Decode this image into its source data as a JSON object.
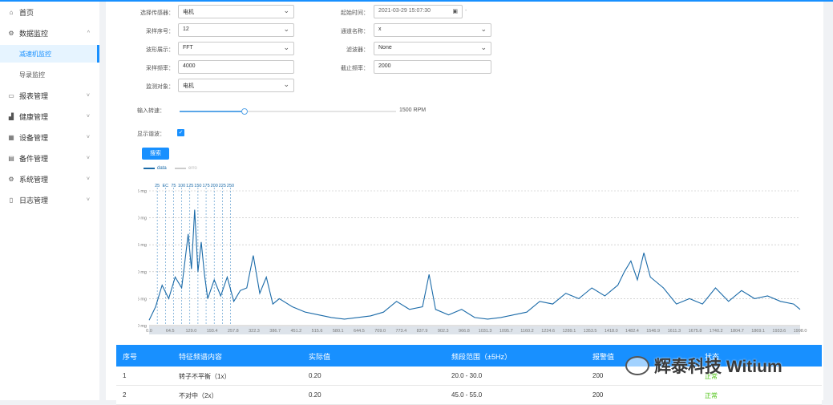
{
  "sidebar": {
    "items": [
      {
        "label": "首页",
        "icon": "home-icon",
        "glyph": "⌂"
      },
      {
        "label": "数据监控",
        "icon": "gear-icon",
        "glyph": "⚙",
        "chevron": "^"
      },
      {
        "label": "减速机监控",
        "sub": true,
        "active": true
      },
      {
        "label": "导录监控",
        "sub": true
      },
      {
        "label": "报表管理",
        "icon": "report-icon",
        "glyph": "▭",
        "chevron": "˅"
      },
      {
        "label": "健康管理",
        "icon": "chart-icon",
        "glyph": "▟",
        "chevron": "˅"
      },
      {
        "label": "设备管理",
        "icon": "device-icon",
        "glyph": "▦",
        "chevron": "˅"
      },
      {
        "label": "备件管理",
        "icon": "parts-icon",
        "glyph": "▤",
        "chevron": "˅"
      },
      {
        "label": "系统管理",
        "icon": "settings-icon",
        "glyph": "⚙",
        "chevron": "˅"
      },
      {
        "label": "日志管理",
        "icon": "log-icon",
        "glyph": "▯",
        "chevron": "˅"
      }
    ]
  },
  "form": {
    "sensor_label": "选择传感器：",
    "sensor_value": "电机",
    "start_time_label": "起始时间：",
    "start_time_value": "2021-03-29 15:07:30",
    "start_time_dash": "-",
    "sample_no_label": "采样序号：",
    "sample_no_value": "12",
    "channel_label": "通道名称：",
    "channel_value": "x",
    "waveform_label": "波形展示：",
    "waveform_value": "FFT",
    "filter_label": "滤波器：",
    "filter_value": "None",
    "sample_rate_label": "采样频率：",
    "sample_rate_value": "4000",
    "cutoff_label": "截止频率：",
    "cutoff_value": "2000",
    "monitor_label": "监测对象：",
    "monitor_value": "电机",
    "speed_label": "输入转速：",
    "speed_value": "1500 RPM",
    "speed_fraction": 0.3,
    "show_label": "显示谐波：",
    "show_checked": true,
    "search_button": "搜索"
  },
  "legend": {
    "data": "data",
    "harmonic": "erro"
  },
  "chart_data": {
    "type": "line",
    "yticks": [
      "0 mg",
      "5 mg",
      "10 mg",
      "15 mg",
      "20 mg",
      "25 mg"
    ],
    "ylim": [
      0,
      25
    ],
    "xticks": [
      "0.0",
      "64.5",
      "129.0",
      "193.4",
      "257.8",
      "322.3",
      "386.7",
      "451.2",
      "515.6",
      "580.1",
      "644.5",
      "709.0",
      "773.4",
      "837.9",
      "902.3",
      "966.8",
      "1031.3",
      "1095.7",
      "1160.2",
      "1224.6",
      "1289.1",
      "1353.5",
      "1418.0",
      "1482.4",
      "1546.9",
      "1611.3",
      "1675.8",
      "1740.2",
      "1804.7",
      "1869.1",
      "1933.6",
      "1998.0"
    ],
    "xlim": [
      0,
      2000
    ],
    "harmonic_labels": [
      "25",
      "EC",
      "75",
      "100",
      "125",
      "150",
      "175",
      "200",
      "225",
      "250"
    ],
    "harmonic_x": [
      25,
      50,
      75,
      100,
      125,
      150,
      175,
      200,
      225,
      250
    ],
    "series": [
      {
        "x": [
          0,
          20,
          40,
          60,
          80,
          100,
          110,
          120,
          130,
          140,
          150,
          160,
          170,
          180,
          200,
          220,
          240,
          260,
          280,
          300,
          320,
          340,
          360,
          380,
          400,
          440,
          480,
          520,
          560,
          600,
          640,
          680,
          720,
          760,
          800,
          840,
          860,
          880,
          920,
          960,
          1000,
          1040,
          1080,
          1120,
          1160,
          1200,
          1240,
          1280,
          1320,
          1360,
          1400,
          1440,
          1460,
          1480,
          1500,
          1520,
          1540,
          1580,
          1620,
          1660,
          1700,
          1740,
          1780,
          1820,
          1860,
          1900,
          1940,
          1980,
          2000
        ],
        "y": [
          1.0,
          3.5,
          7.5,
          5.0,
          9.0,
          7.0,
          12.0,
          17.0,
          10.5,
          21.5,
          10.0,
          15.5,
          9.5,
          5.0,
          8.5,
          5.5,
          9.0,
          4.5,
          6.5,
          7.0,
          13.0,
          6.0,
          9.0,
          4.0,
          5.0,
          3.5,
          2.5,
          2.0,
          1.5,
          1.2,
          1.5,
          1.8,
          2.5,
          4.5,
          3.0,
          3.5,
          9.5,
          3.0,
          2.0,
          3.0,
          1.5,
          1.2,
          1.5,
          2.0,
          2.5,
          4.5,
          4.0,
          6.0,
          5.0,
          7.0,
          5.5,
          7.5,
          10.0,
          12.0,
          8.5,
          13.5,
          9.0,
          7.0,
          4.0,
          5.0,
          4.0,
          7.0,
          4.5,
          6.5,
          5.0,
          5.5,
          4.5,
          4.0,
          3.0
        ]
      }
    ]
  },
  "table": {
    "headers": [
      "序号",
      "特征频谱内容",
      "实际值",
      "频段范围（±5Hz）",
      "报警值",
      "状态"
    ],
    "rows": [
      [
        "1",
        "转子不平衡（1x）",
        "0.20",
        "20.0 - 30.0",
        "200",
        "正常"
      ],
      [
        "2",
        "不对中（2x）",
        "0.20",
        "45.0 - 55.0",
        "200",
        "正常"
      ]
    ]
  },
  "watermark": {
    "text": "辉泰科技 Witium"
  }
}
